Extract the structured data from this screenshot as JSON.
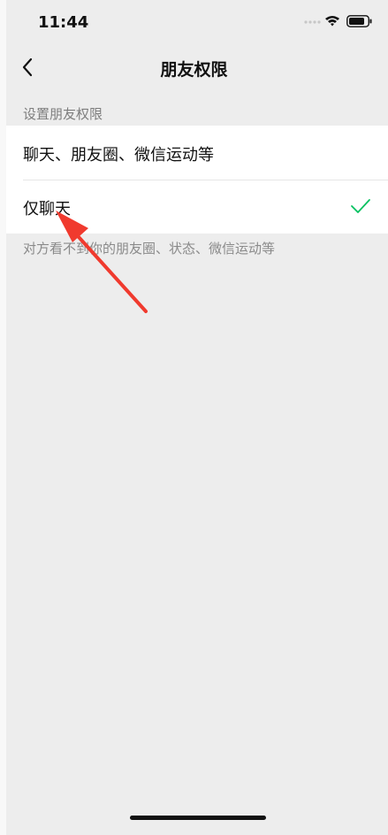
{
  "status_bar": {
    "time": "11:44"
  },
  "nav": {
    "title": "朋友权限",
    "back_icon": "chevron-left-icon"
  },
  "section": {
    "label": "设置朋友权限"
  },
  "options": [
    {
      "label": "聊天、朋友圈、微信运动等",
      "selected": false
    },
    {
      "label": "仅聊天",
      "selected": true
    }
  ],
  "hint": "对方看不到你的朋友圈、状态、微信运动等",
  "colors": {
    "background": "#ededed",
    "check": "#07c160",
    "annotation_arrow": "#f03a2e"
  }
}
